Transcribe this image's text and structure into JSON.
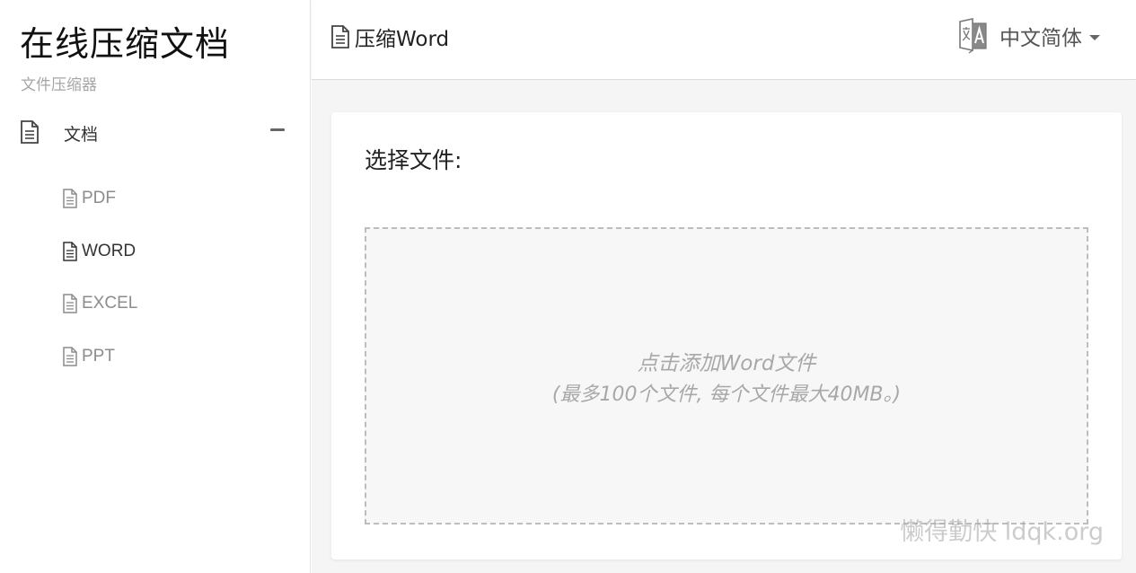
{
  "sidebar": {
    "title": "在线压缩文档",
    "subtitle": "文件压缩器",
    "group": {
      "label": "文档",
      "icon": "document-icon",
      "collapse_icon": "minus-icon"
    },
    "items": [
      {
        "label": "PDF",
        "icon": "document-icon",
        "active": false
      },
      {
        "label": "WORD",
        "icon": "document-icon",
        "active": true
      },
      {
        "label": "EXCEL",
        "icon": "document-icon",
        "active": false
      },
      {
        "label": "PPT",
        "icon": "document-icon",
        "active": false
      }
    ]
  },
  "header": {
    "title": "压缩Word",
    "title_icon": "document-icon",
    "language": {
      "label": "中文简体",
      "icon": "translate-icon",
      "caret_icon": "caret-down-icon"
    }
  },
  "main": {
    "card_title": "选择文件:",
    "dropzone": {
      "line1": "点击添加Word文件",
      "line2": "(最多100个文件, 每个文件最大40MB。)"
    }
  },
  "watermark": "懒得勤快 ldqk.org",
  "colors": {
    "accent_text": "#333333",
    "muted_text": "#8c8c8c",
    "main_bg": "#f5f5f5",
    "dashed_border": "#bdbdbd"
  }
}
